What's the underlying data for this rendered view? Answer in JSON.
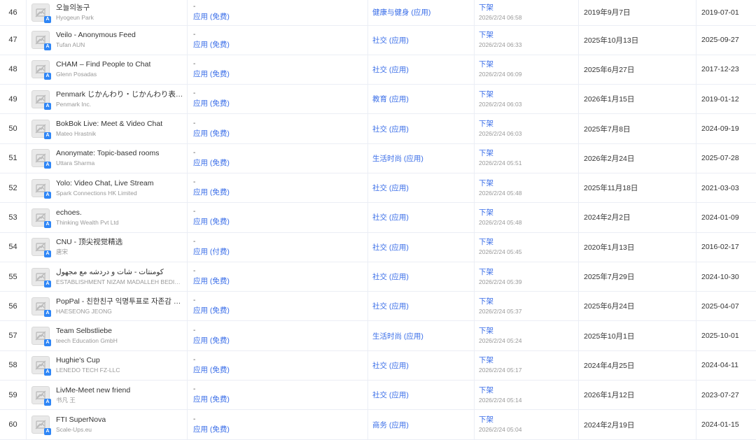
{
  "table": {
    "rows": [
      {
        "rank": "46",
        "name": "오늘의농구",
        "developer": "Hyogeun Park",
        "price_dash": "-",
        "price": "应用 (免费)",
        "category": "健康与健身 (应用)",
        "status": "下架",
        "status_time": "2026/2/24 06:58",
        "release_date": "2019年9月7日",
        "update_date": "2019-07-01"
      },
      {
        "rank": "47",
        "name": "Veilo - Anonymous Feed",
        "developer": "Tufan AUN",
        "price_dash": "-",
        "price": "应用 (免费)",
        "category": "社交 (应用)",
        "status": "下架",
        "status_time": "2026/2/24 06:33",
        "release_date": "2025年10月13日",
        "update_date": "2025-09-27"
      },
      {
        "rank": "48",
        "name": "CHAM – Find People to Chat",
        "developer": "Glenn Posadas",
        "price_dash": "-",
        "price": "应用 (免费)",
        "category": "社交 (应用)",
        "status": "下架",
        "status_time": "2026/2/24 06:09",
        "release_date": "2025年6月27日",
        "update_date": "2017-12-23"
      },
      {
        "rank": "49",
        "name": "Penmark じかんわり・じかんわり表…",
        "developer": "Penmark Inc.",
        "price_dash": "-",
        "price": "应用 (免费)",
        "category": "教育 (应用)",
        "status": "下架",
        "status_time": "2026/2/24 06:03",
        "release_date": "2026年1月15日",
        "update_date": "2019-01-12"
      },
      {
        "rank": "50",
        "name": "BokBok Live: Meet & Video Chat",
        "developer": "Mateo Hrastnik",
        "price_dash": "-",
        "price": "应用 (免费)",
        "category": "社交 (应用)",
        "status": "下架",
        "status_time": "2026/2/24 06:03",
        "release_date": "2025年7月8日",
        "update_date": "2024-09-19"
      },
      {
        "rank": "51",
        "name": "Anonymate: Topic-based rooms",
        "developer": "Uttara Sharma",
        "price_dash": "-",
        "price": "应用 (免费)",
        "category": "生活时尚 (应用)",
        "status": "下架",
        "status_time": "2026/2/24 05:51",
        "release_date": "2026年2月24日",
        "update_date": "2025-07-28"
      },
      {
        "rank": "52",
        "name": "Yolo: Video Chat, Live Stream",
        "developer": "Spark Connections HK Limited",
        "price_dash": "-",
        "price": "应用 (免费)",
        "category": "社交 (应用)",
        "status": "下架",
        "status_time": "2026/2/24 05:48",
        "release_date": "2025年11月18日",
        "update_date": "2021-03-03"
      },
      {
        "rank": "53",
        "name": "echoes.",
        "developer": "Thinking Wealth Pvt Ltd",
        "price_dash": "-",
        "price": "应用 (免费)",
        "category": "社交 (应用)",
        "status": "下架",
        "status_time": "2026/2/24 05:48",
        "release_date": "2024年2月2日",
        "update_date": "2024-01-09"
      },
      {
        "rank": "54",
        "name": "CNU - 顶尖视觉精选",
        "developer": "唐宋",
        "price_dash": "-",
        "price": "应用 (付费)",
        "category": "社交 (应用)",
        "status": "下架",
        "status_time": "2026/2/24 05:45",
        "release_date": "2020年1月13日",
        "update_date": "2016-02-17"
      },
      {
        "rank": "55",
        "name": "كومنتات - شات و دردشه مع مجهول",
        "developer": "ESTABLISHMENT NIZAM MADALLEH BEDI…",
        "price_dash": "-",
        "price": "应用 (免费)",
        "category": "社交 (应用)",
        "status": "下架",
        "status_time": "2026/2/24 05:39",
        "release_date": "2025年7月29日",
        "update_date": "2024-10-30"
      },
      {
        "rank": "56",
        "name": "PopPal - 친한친구 익명투표로 자존감 …",
        "developer": "HAESEONG JEONG",
        "price_dash": "-",
        "price": "应用 (免费)",
        "category": "社交 (应用)",
        "status": "下架",
        "status_time": "2026/2/24 05:37",
        "release_date": "2025年6月24日",
        "update_date": "2025-04-07"
      },
      {
        "rank": "57",
        "name": "Team Selbstliebe",
        "developer": "teech Education GmbH",
        "price_dash": "-",
        "price": "应用 (免费)",
        "category": "生活时尚 (应用)",
        "status": "下架",
        "status_time": "2026/2/24 05:24",
        "release_date": "2025年10月1日",
        "update_date": "2025-10-01"
      },
      {
        "rank": "58",
        "name": "Hughie's Cup",
        "developer": "LENEDO TECH FZ-LLC",
        "price_dash": "-",
        "price": "应用 (免费)",
        "category": "社交 (应用)",
        "status": "下架",
        "status_time": "2026/2/24 05:17",
        "release_date": "2024年4月25日",
        "update_date": "2024-04-11"
      },
      {
        "rank": "59",
        "name": "LivMe-Meet new friend",
        "developer": "书凡 王",
        "price_dash": "-",
        "price": "应用 (免费)",
        "category": "社交 (应用)",
        "status": "下架",
        "status_time": "2026/2/24 05:14",
        "release_date": "2026年1月12日",
        "update_date": "2023-07-27"
      },
      {
        "rank": "60",
        "name": "FTI SuperNova",
        "developer": "Scale-Ups.eu",
        "price_dash": "-",
        "price": "应用 (免费)",
        "category": "商务 (应用)",
        "status": "下架",
        "status_time": "2026/2/24 05:04",
        "release_date": "2024年2月19日",
        "update_date": "2024-01-15"
      }
    ]
  },
  "icons": {
    "placeholder": "broken-image-icon",
    "badge": "app-store-icon"
  },
  "colors": {
    "link": "#3a6ee8",
    "badge": "#2f86f6",
    "muted": "#999999",
    "border": "#ebeef5"
  }
}
